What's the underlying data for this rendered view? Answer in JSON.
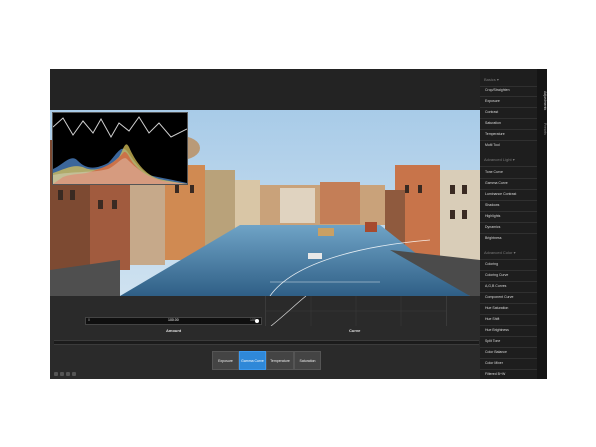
{
  "sidebar": {
    "sections": [
      {
        "title": "Basics",
        "items": [
          "Crop/Straighten",
          "Exposure",
          "Contrast",
          "Saturation",
          "Temperature",
          "Multi Tool"
        ]
      },
      {
        "title": "Advanced Light",
        "items": [
          "Tone Curve",
          "Gamma Curve",
          "Luminance Contrast",
          "Shadows",
          "Highlights",
          "Dynamics",
          "Brightness"
        ]
      },
      {
        "title": "Advanced Color",
        "items": [
          "Coloring",
          "Coloring Curve",
          "A,G,B Curves",
          "Component Curve",
          "Hue Saturation",
          "Hue Shift",
          "Hue Brightness",
          "Split Tone",
          "Color Balance",
          "Color Mixer",
          "Filtered B+W"
        ]
      }
    ]
  },
  "side_tabs": {
    "adjustments": "Adjustments",
    "presets": "Presets"
  },
  "controls": {
    "slider": {
      "min": "0",
      "max": "100",
      "value": "100.00"
    },
    "amount_label": "Amount",
    "curve_label": "Curve",
    "tool_buttons": [
      {
        "label": "Exposure",
        "active": false
      },
      {
        "label": "Gamma Curve",
        "active": true
      },
      {
        "label": "Temperature",
        "active": false
      },
      {
        "label": "Saturation",
        "active": false
      }
    ]
  },
  "colors": {
    "accent": "#2f88d8",
    "panel": "#2a2a2a",
    "sidebar": "#1e1e1e"
  },
  "icons": [
    "chevron-down-icon",
    "grid-icon",
    "compare-icon",
    "fullscreen-icon"
  ]
}
